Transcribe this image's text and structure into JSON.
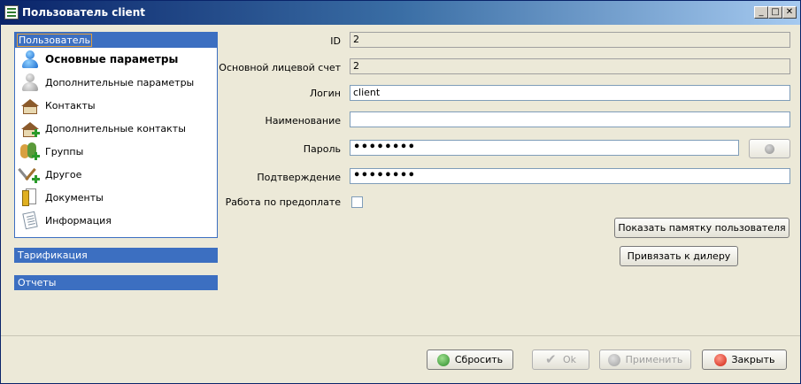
{
  "window": {
    "title": "Пользователь client",
    "controls": {
      "minimize": "_",
      "maximize": "□",
      "close": "✕"
    }
  },
  "nav": {
    "header": "Пользователь",
    "items": [
      {
        "label": "Основные параметры",
        "icon": "user-blue-icon",
        "active": true
      },
      {
        "label": "Дополнительные параметры",
        "icon": "user-grey-icon"
      },
      {
        "label": "Контакты",
        "icon": "house-icon"
      },
      {
        "label": "Дополнительные контакты",
        "icon": "house-add-icon"
      },
      {
        "label": "Группы",
        "icon": "group-add-icon"
      },
      {
        "label": "Другое",
        "icon": "tools-add-icon"
      },
      {
        "label": "Документы",
        "icon": "documents-icon"
      },
      {
        "label": "Информация",
        "icon": "info-sheet-icon"
      }
    ],
    "sections": [
      "Тарификация",
      "Отчеты"
    ]
  },
  "form": {
    "id": {
      "label": "ID",
      "value": "2"
    },
    "account": {
      "label": "Основной лицевой счет",
      "value": "2"
    },
    "login": {
      "label": "Логин",
      "value": "client"
    },
    "name": {
      "label": "Наименование",
      "value": ""
    },
    "password": {
      "label": "Пароль",
      "value": "••••••••"
    },
    "confirm": {
      "label": "Подтверждение",
      "value": "••••••••"
    },
    "prepay": {
      "label": "Работа по предоплате",
      "checked": false
    }
  },
  "actions": {
    "show_memo": "Показать памятку пользователя",
    "bind_dealer": "Привязать к дилеру"
  },
  "footer": {
    "reset": "Сбросить",
    "ok": "Ok",
    "apply": "Применить",
    "close": "Закрыть"
  }
}
